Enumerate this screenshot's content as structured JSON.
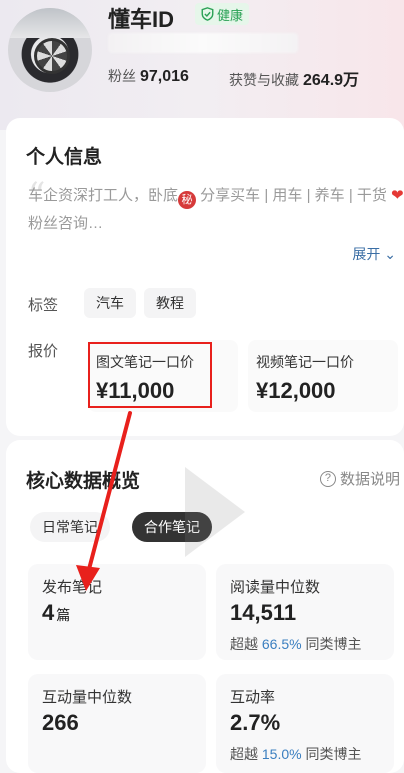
{
  "profile": {
    "name": "懂车ID",
    "health": "健康",
    "fans_label": "粉丝",
    "fans_value": "97,016",
    "likes_label": "获赞与收藏",
    "likes_value": "264.9万"
  },
  "info": {
    "title": "个人信息",
    "bio_part1": "车企资深打工人，卧底",
    "bio_secret": "秘",
    "bio_part2": " 分享买车 | 用车 | 养车 | 干货 ",
    "bio_part3": "粉丝咨询…",
    "expand_label": "展开",
    "tags_label": "标签",
    "tags": [
      "汽车",
      "教程"
    ],
    "price_label": "报价",
    "prices": [
      {
        "label": "图文笔记一口价",
        "value": "¥11,000"
      },
      {
        "label": "视频笔记一口价",
        "value": "¥12,000"
      }
    ]
  },
  "data_overview": {
    "title": "核心数据概览",
    "help_label": "数据说明",
    "tabs": [
      {
        "label": "日常笔记",
        "active": false
      },
      {
        "label": "合作笔记",
        "active": true
      }
    ],
    "metrics": [
      {
        "label": "发布笔记",
        "value": "4",
        "unit": "篇",
        "sub_prefix": "",
        "sub_pct": "",
        "sub_suffix": ""
      },
      {
        "label": "阅读量中位数",
        "value": "14,511",
        "unit": "",
        "sub_prefix": "超越",
        "sub_pct": "66.5%",
        "sub_suffix": "同类博主"
      },
      {
        "label": "互动量中位数",
        "value": "266",
        "unit": "",
        "sub_prefix": "",
        "sub_pct": "",
        "sub_suffix": ""
      },
      {
        "label": "互动率",
        "value": "2.7%",
        "unit": "",
        "sub_prefix": "超越",
        "sub_pct": "15.0%",
        "sub_suffix": "同类博主"
      }
    ]
  },
  "colors": {
    "accent_blue": "#3b7fc0",
    "health_green": "#2aa155",
    "annotation_red": "#e8201c"
  }
}
